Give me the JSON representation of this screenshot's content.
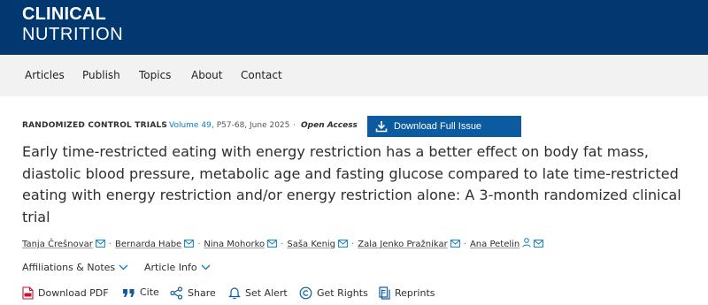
{
  "journal": {
    "line1": "CLINICAL",
    "line2": "NUTRITION"
  },
  "nav": {
    "items": [
      "Articles",
      "Publish",
      "Topics",
      "About",
      "Contact"
    ]
  },
  "article_meta": {
    "section": "RANDOMIZED CONTROL TRIALS",
    "separator": "·",
    "volume": "Volume 49",
    "pages_date": ", P57-68, June 2025",
    "access": "Open Access",
    "download_issue": "Download Full Issue"
  },
  "title": "Early time-restricted eating with energy restriction has a better effect on body fat mass, diastolic blood pressure, metabolic age and fasting glucose compared to late time-restricted eating with energy restriction and/or energy restriction alone: A 3-month randomized clinical trial",
  "authors": [
    "Tanja Črešnovar",
    "Bernarda Habe",
    "Nina Mohorko",
    "Saša Kenig",
    "Zala Jenko Pražnikar",
    "Ana Petelin"
  ],
  "toggles": {
    "affiliations": "Affiliations & Notes",
    "article_info": "Article Info"
  },
  "actions": {
    "download_pdf": "Download PDF",
    "cite": "Cite",
    "share": "Share",
    "set_alert": "Set Alert",
    "get_rights": "Get Rights",
    "reprints": "Reprints"
  },
  "colors": {
    "masthead": "#00386f",
    "link": "#0c7dbb",
    "button": "#0c5aa0",
    "pdf": "#c8102e"
  },
  "icons": [
    "download-icon",
    "mail-icon",
    "person-icon",
    "chevron-down-icon",
    "pdf-icon",
    "quote-icon",
    "share-icon",
    "bell-icon",
    "copyright-icon",
    "reprints-icon"
  ]
}
